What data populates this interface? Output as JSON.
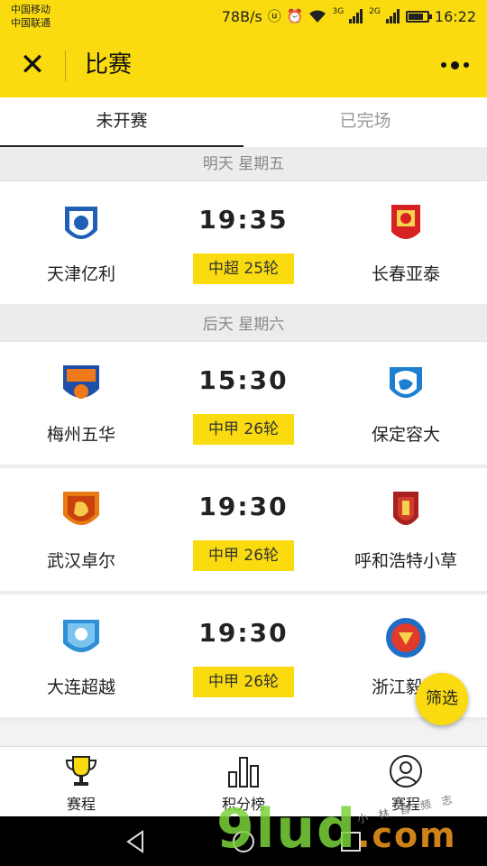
{
  "status_bar": {
    "carrier_1": "中国移动",
    "carrier_2": "中国联通",
    "speed": "78B/s",
    "net_1": "3G",
    "net_2": "2G",
    "time": "16:22",
    "battery_level": 0.75
  },
  "titlebar": {
    "close_glyph": "✕",
    "title": "比赛",
    "more_icon": "more-dots-icon"
  },
  "tabs": [
    {
      "label": "未开赛",
      "active": true
    },
    {
      "label": "已完场",
      "active": false
    }
  ],
  "days": [
    {
      "label": "明天 星期五",
      "matches": [
        {
          "home": "天津亿利",
          "away": "长春亚泰",
          "time": "19:35",
          "round": "中超 25轮"
        }
      ]
    },
    {
      "label": "后天 星期六",
      "matches": [
        {
          "home": "梅州五华",
          "away": "保定容大",
          "time": "15:30",
          "round": "中甲 26轮"
        },
        {
          "home": "武汉卓尔",
          "away": "呼和浩特小草",
          "time": "19:30",
          "round": "中甲 26轮"
        },
        {
          "home": "大连超越",
          "away": "浙江毅腾",
          "time": "19:30",
          "round": "中甲 26轮"
        }
      ]
    }
  ],
  "filter_button": {
    "label": "筛选"
  },
  "bottom_nav": [
    {
      "label": "赛程",
      "icon": "trophy-icon"
    },
    {
      "label": "积分榜",
      "icon": "bar-chart-icon"
    },
    {
      "label": "赛程",
      "icon": "profile-icon"
    }
  ],
  "colors": {
    "accent": "#f9db0f",
    "text": "#222222",
    "muted": "#999999"
  },
  "watermark": {
    "main": "9lud",
    "suffix": ".com",
    "small": "小 林 音 频 志"
  }
}
